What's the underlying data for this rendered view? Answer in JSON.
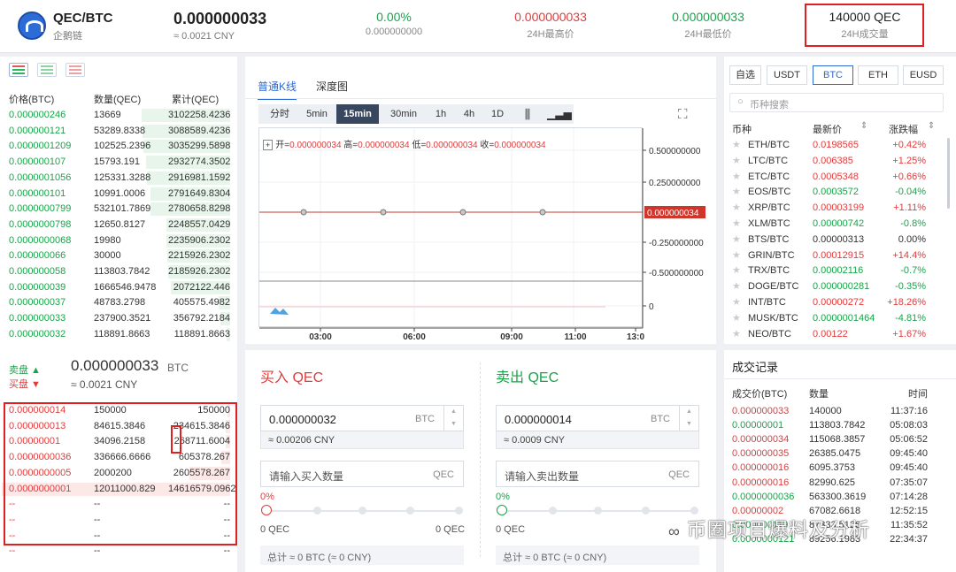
{
  "header": {
    "pair": "QEC/BTC",
    "subname": "企鹅链",
    "last_price": "0.000000033",
    "last_cny": "≈ 0.0021 CNY",
    "change_pct": "0.00%",
    "change_abs": "0.000000000",
    "high": "0.000000033",
    "high_label": "24H最高价",
    "low": "0.000000033",
    "low_label": "24H最低价",
    "volume": "140000 QEC",
    "volume_label": "24H成交量"
  },
  "orderbook": {
    "headers": [
      "价格(BTC)",
      "数量(QEC)",
      "累计(QEC)"
    ],
    "buy_rows": [
      [
        "0.000000246",
        "13669",
        "3102258.4236"
      ],
      [
        "0.000000121",
        "53289.8338",
        "3088589.4236"
      ],
      [
        "0.0000001209",
        "102525.2396",
        "3035299.5898"
      ],
      [
        "0.000000107",
        "15793.191",
        "2932774.3502"
      ],
      [
        "0.0000001056",
        "125331.3288",
        "2916981.1592"
      ],
      [
        "0.000000101",
        "10991.0006",
        "2791649.8304"
      ],
      [
        "0.0000000799",
        "532101.7869",
        "2780658.8298"
      ],
      [
        "0.0000000798",
        "12650.8127",
        "2248557.0429"
      ],
      [
        "0.0000000068",
        "19980",
        "2235906.2302"
      ],
      [
        "0.000000066",
        "30000",
        "2215926.2302"
      ],
      [
        "0.000000058",
        "113803.7842",
        "2185926.2302"
      ],
      [
        "0.000000039",
        "1666546.9478",
        "2072122.446"
      ],
      [
        "0.000000037",
        "48783.2798",
        "405575.4982"
      ],
      [
        "0.000000033",
        "237900.3521",
        "356792.2184"
      ],
      [
        "0.000000032",
        "118891.8663",
        "118891.8663"
      ]
    ],
    "buy_fill": [
      1.0,
      0.99,
      0.98,
      0.95,
      0.94,
      0.9,
      0.9,
      0.72,
      0.72,
      0.71,
      0.7,
      0.67,
      0.13,
      0.11,
      0.04
    ],
    "sell_label": "卖盘 ▲",
    "buy_label": "买盘 ▼",
    "mid_price": "0.000000033",
    "mid_unit": "BTC",
    "mid_cny": "≈ 0.0021 CNY",
    "sell_rows": [
      [
        "0.000000014",
        "150000",
        "150000"
      ],
      [
        "0.000000013",
        "84615.3846",
        "234615.3846"
      ],
      [
        "0.00000001",
        "34096.2158",
        "268711.6004"
      ],
      [
        "0.0000000036",
        "336666.6666",
        "605378.267"
      ],
      [
        "0.0000000005",
        "2000200",
        "2605578.267"
      ],
      [
        "0.0000000001",
        "12011000.829",
        "14616579.0962"
      ],
      [
        "--",
        "--",
        "--"
      ],
      [
        "--",
        "--",
        "--"
      ],
      [
        "--",
        "--",
        "--"
      ],
      [
        "--",
        "--",
        "--"
      ]
    ],
    "sell_fill": [
      0.01,
      0.02,
      0.02,
      0.04,
      0.18,
      1.0,
      0,
      0,
      0,
      0
    ]
  },
  "chart": {
    "tabs": [
      "普通K线",
      "深度图"
    ],
    "periods": [
      "分时",
      "5min",
      "15min",
      "30min",
      "1h",
      "4h",
      "1D"
    ],
    "active_period": "15min",
    "ohlc_open_label": "开=",
    "ohlc_open": "0.000000034",
    "ohlc_high_label": "高=",
    "ohlc_high": "0.000000034",
    "ohlc_low_label": "低=",
    "ohlc_low": "0.000000034",
    "ohlc_close_label": "收=",
    "ohlc_close": "0.000000034",
    "current_price_tag": "0.000000034"
  },
  "chart_data": {
    "type": "line",
    "title": "",
    "xlabel": "",
    "ylabel": "",
    "x": [
      "03:00",
      "06:00",
      "09:00",
      "11:00",
      "13:0"
    ],
    "y_ticks": [
      "0.500000000",
      "0.250000000",
      "-0.250000000",
      "-0.500000000",
      "0"
    ],
    "series": [
      {
        "values": [
          3.4e-08,
          3.4e-08,
          3.4e-08,
          3.4e-08
        ]
      }
    ],
    "grid": true
  },
  "buy": {
    "title": "买入 QEC",
    "price": "0.000000032",
    "price_unit": "BTC",
    "price_cny": "≈ 0.00206 CNY",
    "amount_placeholder": "请输入买入数量",
    "amount_unit": "QEC",
    "pct": "0%",
    "avail_left": "0 QEC",
    "avail_right": "0 QEC",
    "total": "总计 ≈ 0 BTC (≈ 0 CNY)"
  },
  "sell": {
    "title": "卖出 QEC",
    "price": "0.000000014",
    "price_unit": "BTC",
    "price_cny": "≈ 0.0009 CNY",
    "amount_placeholder": "请输入卖出数量",
    "amount_unit": "QEC",
    "pct": "0%",
    "avail_left": "0 QEC",
    "total": "总计 ≈ 0 BTC (≈ 0 CNY)"
  },
  "markets": {
    "tabs": [
      "自选",
      "USDT",
      "BTC",
      "ETH",
      "EUSD"
    ],
    "active_tab": "BTC",
    "search_placeholder": "币种搜索",
    "headers": [
      "币种",
      "最新价",
      "涨跌幅"
    ],
    "rows": [
      [
        "ETH/BTC",
        "0.0198565",
        "+0.42%",
        "up"
      ],
      [
        "LTC/BTC",
        "0.006385",
        "+1.25%",
        "up"
      ],
      [
        "ETC/BTC",
        "0.0005348",
        "+0.66%",
        "up"
      ],
      [
        "EOS/BTC",
        "0.0003572",
        "-0.04%",
        "down"
      ],
      [
        "XRP/BTC",
        "0.00003199",
        "+1.11%",
        "up"
      ],
      [
        "XLM/BTC",
        "0.00000742",
        "-0.8%",
        "down"
      ],
      [
        "BTS/BTC",
        "0.00000313",
        "0.00%",
        "flat"
      ],
      [
        "GRIN/BTC",
        "0.00012915",
        "+14.4%",
        "up"
      ],
      [
        "TRX/BTC",
        "0.00002116",
        "-0.7%",
        "down"
      ],
      [
        "DOGE/BTC",
        "0.000000281",
        "-0.35%",
        "down"
      ],
      [
        "INT/BTC",
        "0.00000272",
        "+18.26%",
        "up"
      ],
      [
        "MUSK/BTC",
        "0.0000001464",
        "-4.81%",
        "down"
      ],
      [
        "NEO/BTC",
        "0.00122",
        "+1.67%",
        "up"
      ]
    ]
  },
  "trades": {
    "title": "成交记录",
    "headers": [
      "成交价(BTC)",
      "数量",
      "时间"
    ],
    "rows": [
      [
        "0.000000033",
        "140000",
        "11:37:16",
        "red"
      ],
      [
        "0.00000001",
        "113803.7842",
        "05:08:03",
        "green"
      ],
      [
        "0.000000034",
        "115068.3857",
        "05:06:52",
        "red"
      ],
      [
        "0.000000035",
        "26385.0475",
        "09:45:40",
        "red"
      ],
      [
        "0.000000016",
        "6095.3753",
        "09:45:40",
        "red"
      ],
      [
        "0.000000016",
        "82990.625",
        "07:35:07",
        "red"
      ],
      [
        "0.0000000036",
        "563300.3619",
        "07:14:28",
        "green"
      ],
      [
        "0.00000002",
        "67082.6618",
        "12:52:15",
        "red"
      ],
      [
        "0.000000119",
        "87333.5126",
        "11:35:52",
        "green"
      ],
      [
        "0.0000000121",
        "89256.1983",
        "22:34:37",
        "green"
      ]
    ]
  },
  "watermark": "币圈项目爆料及分析"
}
